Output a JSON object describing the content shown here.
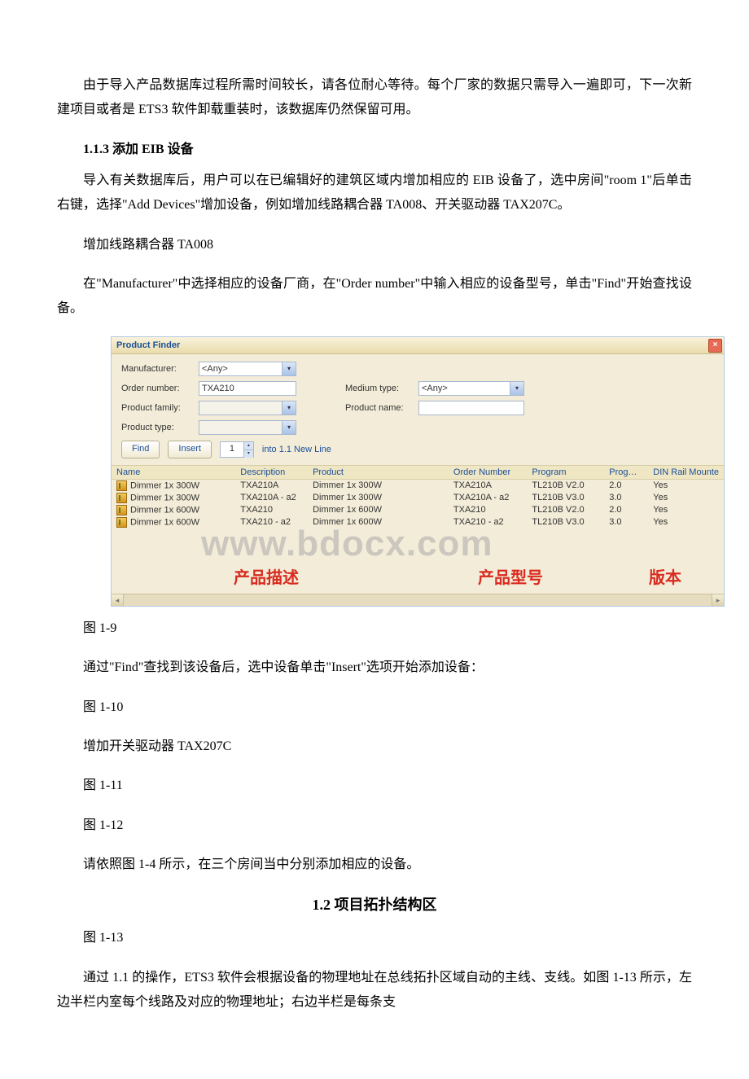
{
  "text": {
    "para1": "由于导入产品数据库过程所需时间较长，请各位耐心等待。每个厂家的数据只需导入一遍即可，下一次新建项目或者是 ETS3 软件卸载重装时，该数据库仍然保留可用。",
    "heading_113": "1.1.3 添加 EIB 设备",
    "para2": "导入有关数据库后，用户可以在已编辑好的建筑区域内增加相应的 EIB 设备了，选中房间\"room 1\"后单击右键，选择\"Add Devices\"增加设备，例如增加线路耦合器 TA008、开关驱动器 TAX207C。",
    "para3": " 增加线路耦合器 TA008",
    "para4": "在\"Manufacturer\"中选择相应的设备厂商，在\"Order number\"中输入相应的设备型号，单击\"Find\"开始查找设备。",
    "fig19": "图 1-9",
    "para5": "通过\"Find\"查找到该设备后，选中设备单击\"Insert\"选项开始添加设备：",
    "fig110": "图 1-10",
    "para6": " 增加开关驱动器 TAX207C",
    "fig111": "图 1-11",
    "fig112": "图 1-12",
    "para7": "请依照图 1-4 所示，在三个房间当中分别添加相应的设备。",
    "heading_12": "1.2 项目拓扑结构区",
    "fig113": "图 1-13",
    "para8": "通过 1.1 的操作，ETS3 软件会根据设备的物理地址在总线拓扑区域自动的主线、支线。如图 1-13 所示，左边半栏内室每个线路及对应的物理地址；右边半栏是每条支"
  },
  "dialog": {
    "title": "Product Finder",
    "labels": {
      "manufacturer": "Manufacturer:",
      "order_number": "Order number:",
      "product_family": "Product family:",
      "product_type": "Product type:",
      "medium_type": "Medium type:",
      "product_name": "Product name:"
    },
    "values": {
      "manufacturer": "<Any>",
      "order_number": "TXA210",
      "medium_type": "<Any>",
      "product_name": ""
    },
    "buttons": {
      "find": "Find",
      "insert": "Insert"
    },
    "spinner_value": "1",
    "into_label": "into  1.1 New Line",
    "columns": {
      "name": "Name",
      "description": "Description",
      "product": "Product",
      "order_number": "Order Number",
      "program": "Program",
      "prog": "Prog…",
      "din": "DIN Rail Mounte"
    },
    "rows": [
      {
        "name": "Dimmer 1x 300W",
        "description": "TXA210A",
        "product": "Dimmer 1x 300W",
        "order": "TXA210A",
        "program": "TL210B V2.0",
        "prog": "2.0",
        "din": "Yes"
      },
      {
        "name": "Dimmer 1x 300W",
        "description": "TXA210A - a2",
        "product": "Dimmer 1x 300W",
        "order": "TXA210A - a2",
        "program": "TL210B V3.0",
        "prog": "3.0",
        "din": "Yes"
      },
      {
        "name": "Dimmer 1x 600W",
        "description": "TXA210",
        "product": "Dimmer 1x 600W",
        "order": "TXA210",
        "program": "TL210B V2.0",
        "prog": "2.0",
        "din": "Yes"
      },
      {
        "name": "Dimmer 1x 600W",
        "description": "TXA210 - a2",
        "product": "Dimmer 1x 600W",
        "order": "TXA210 - a2",
        "program": "TL210B V3.0",
        "prog": "3.0",
        "din": "Yes"
      }
    ]
  },
  "watermark": "www.bdocx.com",
  "red_labels": {
    "desc": "产品描述",
    "model": "产品型号",
    "version": "版本"
  }
}
